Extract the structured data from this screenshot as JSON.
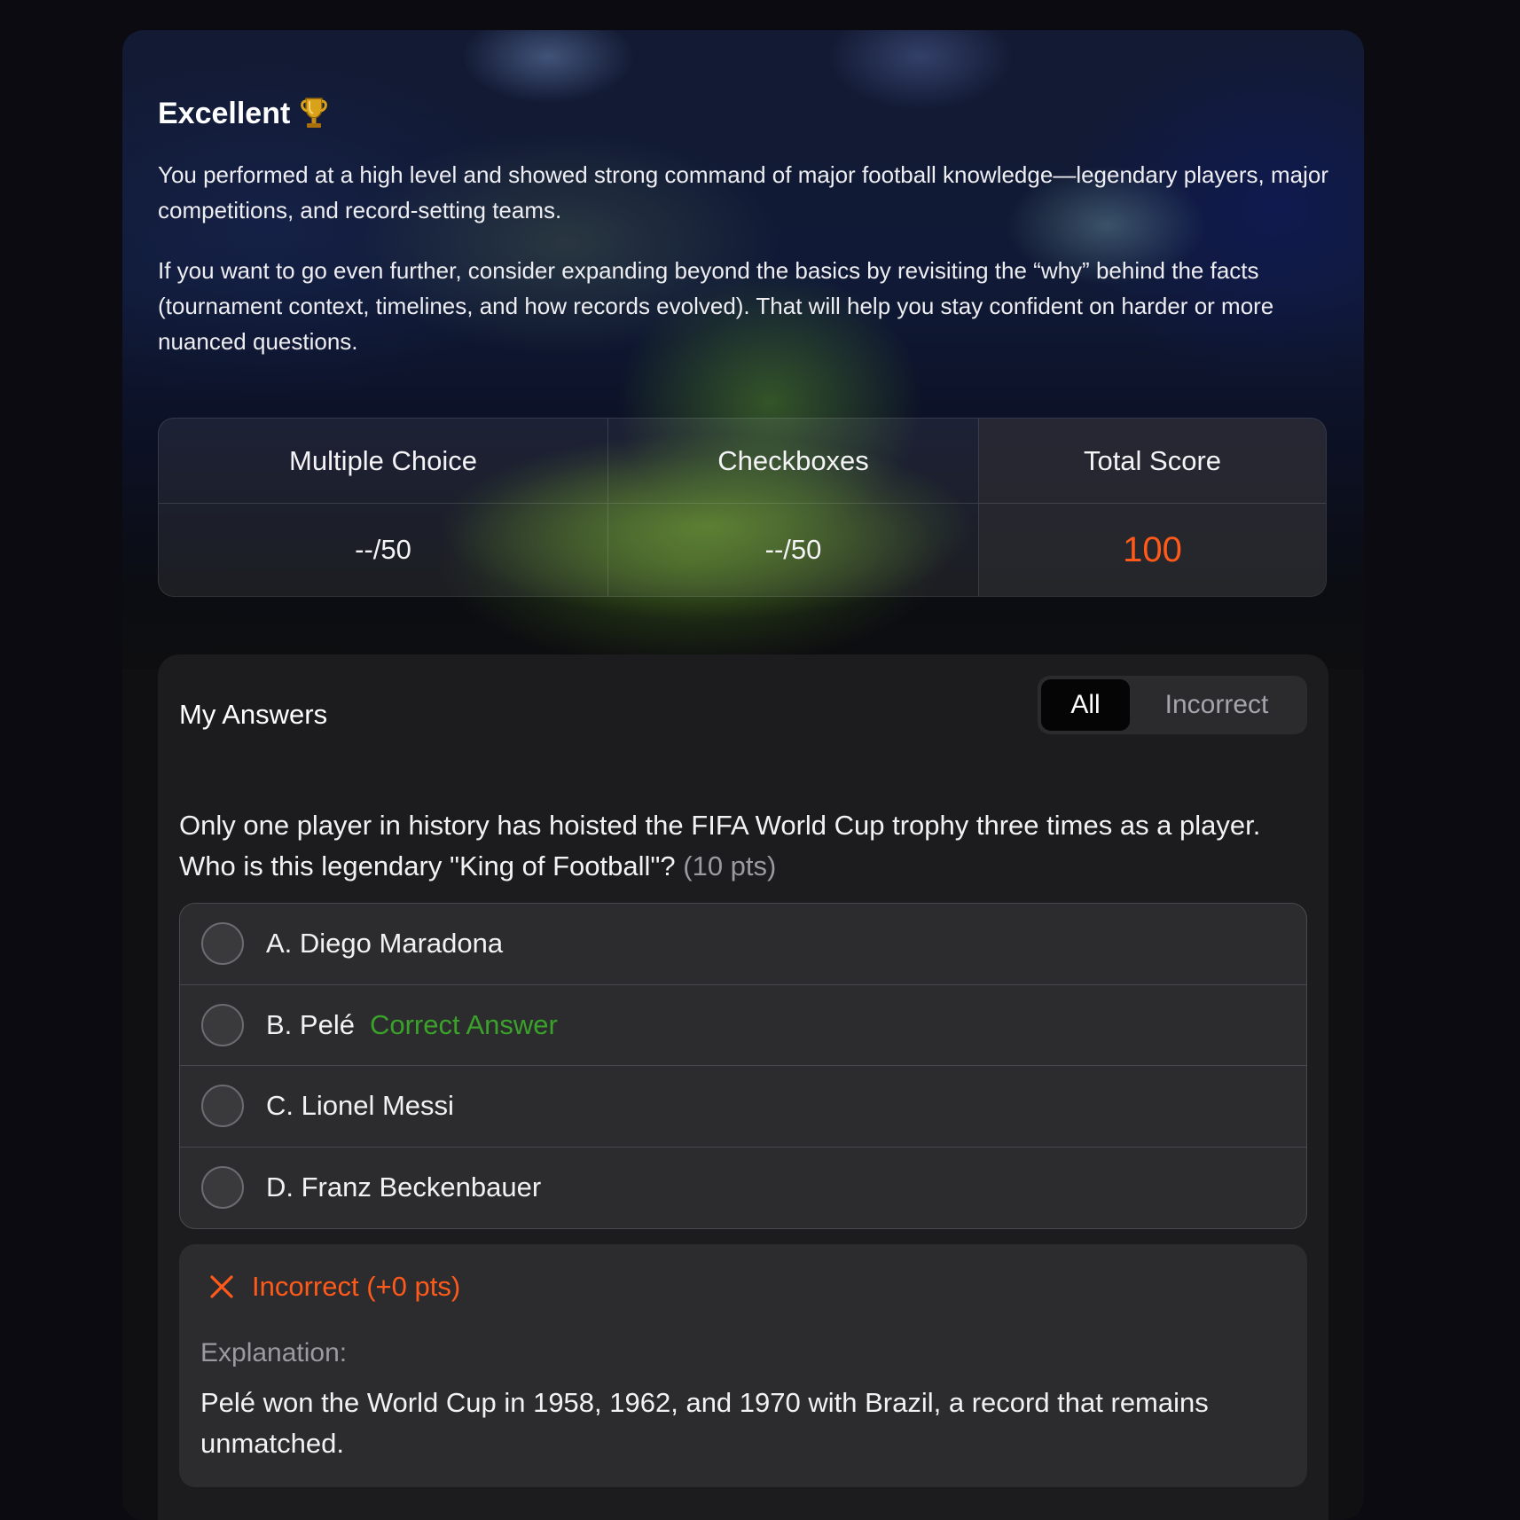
{
  "hero": {
    "title": "Excellent",
    "title_icon": "trophy-icon",
    "paragraph1": "You performed at a high level and showed strong command of major football knowledge—legendary players, major competitions, and record-setting teams.",
    "paragraph2": "If you want to go even further, consider expanding beyond the basics by revisiting the “why” behind the facts (tournament context, timelines, and how records evolved). That will help you stay confident on harder or more nuanced questions."
  },
  "scores": {
    "headers": [
      "Multiple Choice",
      "Checkboxes",
      "Total Score"
    ],
    "values": [
      "--/50",
      "--/50",
      "100"
    ],
    "total_color": "#ff5a1a"
  },
  "answers": {
    "title": "My Answers",
    "filters": {
      "all": "All",
      "incorrect": "Incorrect",
      "selected": "All"
    },
    "question": {
      "text": "Only one player in history has hoisted the FIFA World Cup trophy three times as a player. Who is this legendary \"King of Football\"?",
      "points": "(10 pts)",
      "options": [
        {
          "label": "A. Diego Maradona",
          "tag": ""
        },
        {
          "label": "B. Pelé",
          "tag": "Correct Answer"
        },
        {
          "label": "C. Lionel Messi",
          "tag": ""
        },
        {
          "label": "D. Franz Beckenbauer",
          "tag": ""
        }
      ]
    },
    "result": {
      "status_icon": "x-icon",
      "status": "Incorrect (+0 pts)",
      "explanation_label": "Explanation:",
      "explanation": "Pelé won the World Cup in 1958, 1962, and 1970 with Brazil, a record that remains unmatched."
    }
  },
  "colors": {
    "accent_orange": "#ff5a1a",
    "correct_green": "#3aa22a",
    "background": "#0c0b12",
    "panel": "#1c1c1e"
  }
}
